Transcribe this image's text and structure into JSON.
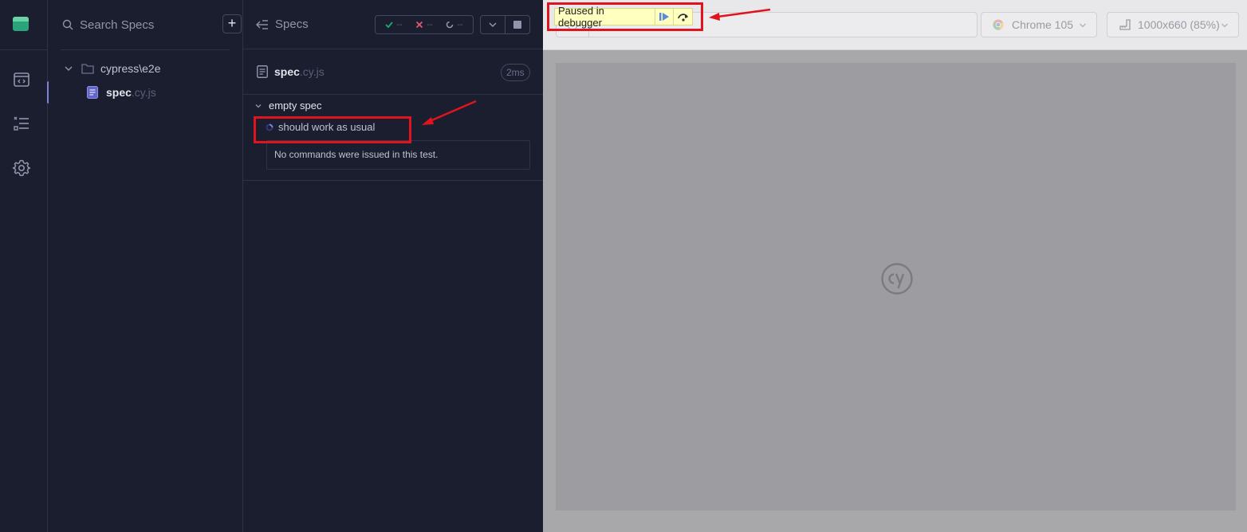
{
  "spec_list": {
    "search_placeholder": "Search Specs",
    "add_label": "+",
    "folder": "cypress\\e2e",
    "file_name": "spec",
    "file_ext": ".cy.js"
  },
  "reporter": {
    "specs_label": "Specs",
    "stats": {
      "passed": "--",
      "failed": "--",
      "pending": "--"
    },
    "file_name": "spec",
    "file_ext": ".cy.js",
    "duration": "2ms",
    "suite_title": "empty spec",
    "test_title": "should work as usual",
    "no_commands": "No commands were issued in this test."
  },
  "aut": {
    "debugger_text": "Paused in debugger",
    "browser": "Chrome 105",
    "viewport": "1000x660 (85%)"
  },
  "colors": {
    "accent": "#7f82d9",
    "annotation": "#e0141e",
    "passed": "#1fa971",
    "failed": "#e45770",
    "debug_banner": "#ffffc0"
  }
}
